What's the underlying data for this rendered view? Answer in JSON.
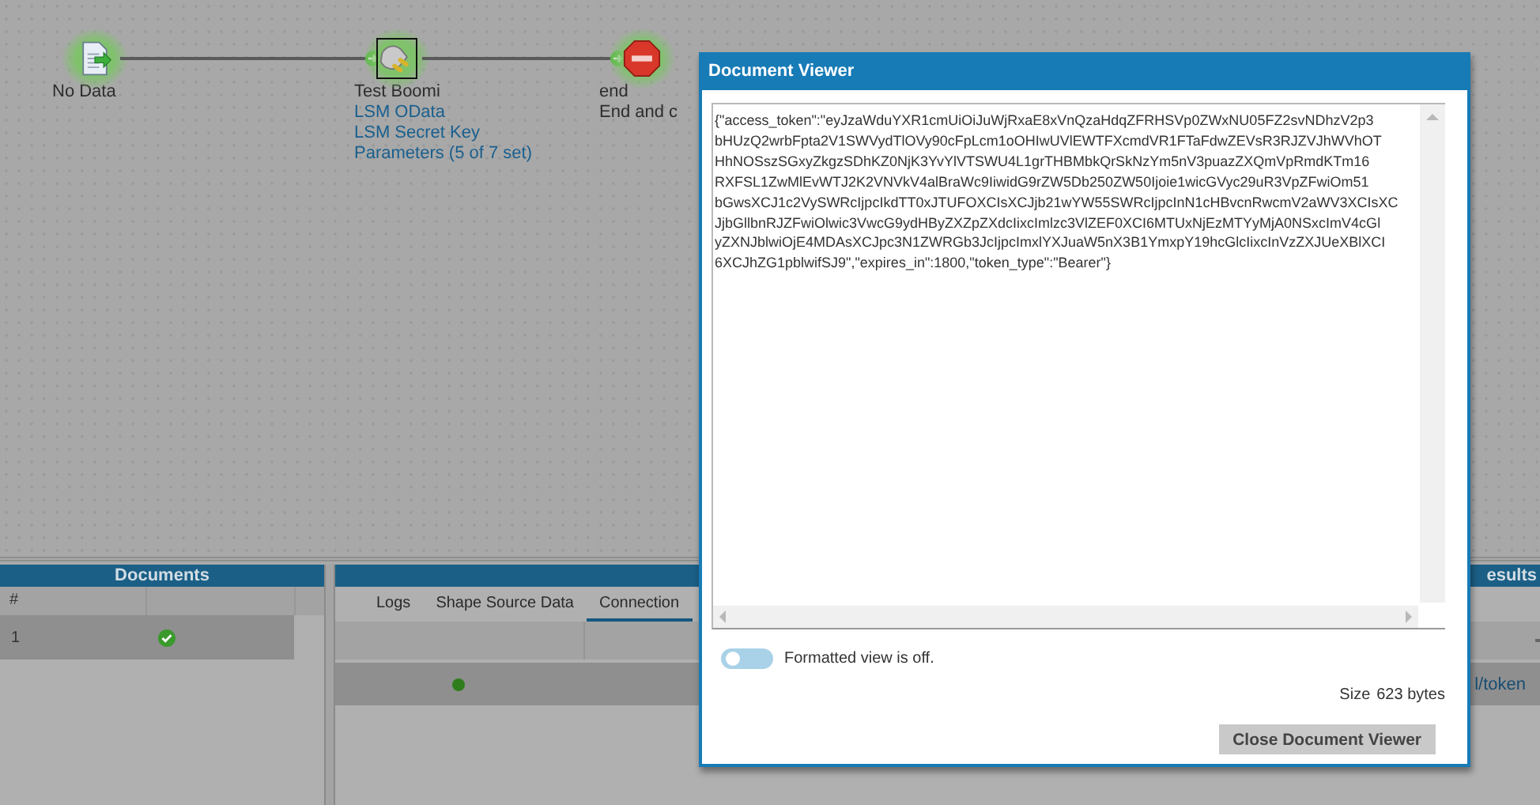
{
  "canvas": {
    "nodes": [
      {
        "kind": "start",
        "label": "No Data",
        "selected": false
      },
      {
        "kind": "connector",
        "label": "Test Boomi",
        "selected": true,
        "links": [
          "LSM OData",
          "LSM Secret Key",
          "Parameters (5 of 7 set)"
        ]
      },
      {
        "kind": "stop",
        "label": "end",
        "selected": false,
        "sublabel": "End and c"
      }
    ]
  },
  "documents_panel": {
    "title": "Documents",
    "columns": [
      "#"
    ],
    "rows": [
      {
        "number": "1",
        "kind": "success"
      }
    ]
  },
  "results_panel": {
    "title": "esults",
    "tabs": [
      {
        "label": "Logs",
        "selected": false
      },
      {
        "label": "Shape Source Data",
        "selected": false
      },
      {
        "label": "Connection",
        "selected": true
      }
    ],
    "rows": [
      {
        "kind": "success",
        "column_3": "l/token"
      }
    ]
  },
  "dialog": {
    "title": "Document Viewer",
    "content_lines": [
      "{\"access_token\":\"eyJzaWduYXR1cmUiOiJuWjRxaE8xVnQzaHdqZFRHSVp0ZWxNU05FZ2svNDhzV2p3",
      "bHUzQ2wrbFpta2V1SWVydTlOVy90cFpLcm1oOHIwUVlEWTFXcmdVR1FTaFdwZEVsR3RJZVJhWVhOT",
      "HhNOSszSGxyZkgzSDhKZ0NjK3YvYlVTSWU4L1grTHBMbkQrSkNzYm5nV3puazZXQmVpRmdKTm16",
      "RXFSL1ZwMlEvWTJ2K2VNVkV4alBraWc9IiwidG9rZW5Db250ZW50Ijoie1wicGVyc29uR3VpZFwiOm51",
      "bGwsXCJ1c2VySWRcIjpcIkdTT0xJTUFOXCIsXCJjb21wYW55SWRcIjpcInN1cHBvcnRwcmV2aWV3XCIsXC",
      "JjbGllbnRJZFwiOlwic3VwcG9ydHByZXZpZXdcIixcImlzc3VlZEF0XCI6MTUxNjEzMTYyMjA0NSxcImV4cGl",
      "yZXNJblwiOjE4MDAsXCJpc3N1ZWRGb3JcIjpcImxlYXJuaW5nX3B1YmxpY19hcGlcIixcInVzZXJUeXBlXCI",
      "6XCJhZG1pblwifSJ9\",\"expires_in\":1800,\"token_type\":\"Bearer\"}"
    ],
    "formatted_view": {
      "on": false,
      "label": "Formatted view is off."
    },
    "size_label": "Size",
    "size_value": "623 bytes",
    "close_button": "Close Document Viewer"
  }
}
